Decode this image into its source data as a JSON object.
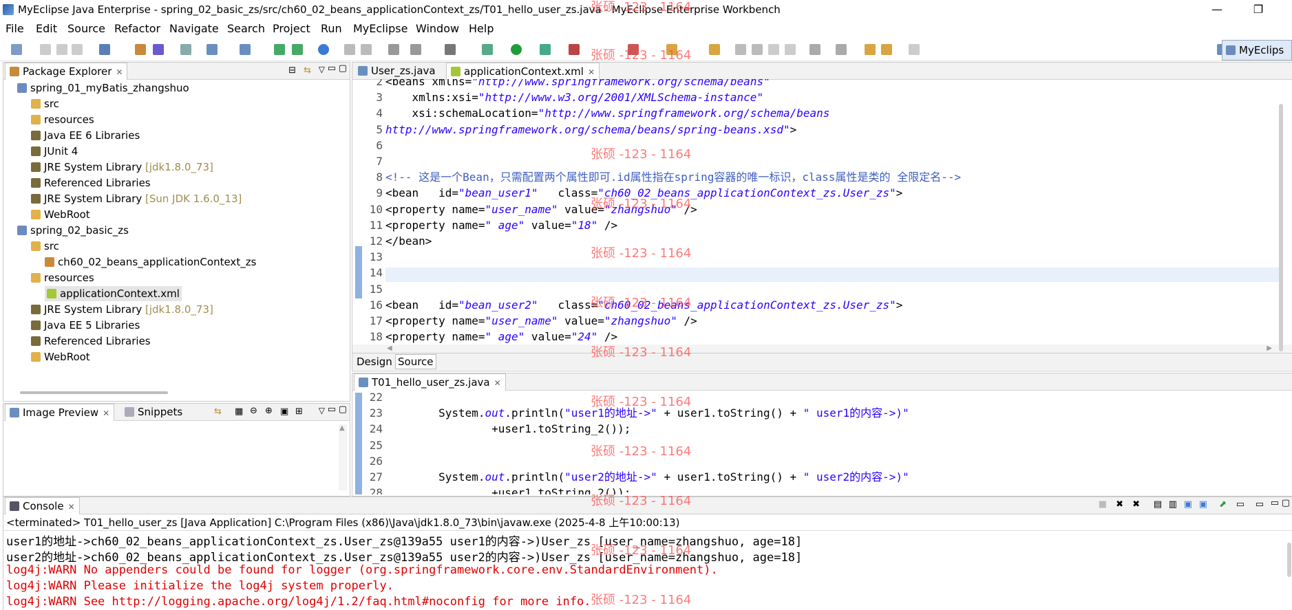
{
  "window": {
    "title": "MyEclipse Java Enterprise - spring_02_basic_zs/src/ch60_02_beans_applicationContext_zs/T01_hello_user_zs.java - MyEclipse Enterprise Workbench",
    "minimize": "—",
    "maximize": "❐"
  },
  "menu": [
    "File",
    "Edit",
    "Source",
    "Refactor",
    "Navigate",
    "Search",
    "Project",
    "Run",
    "MyEclipse",
    "Window",
    "Help"
  ],
  "perspective": "MyEclips",
  "package_explorer": {
    "tab": "Package Explorer",
    "items": [
      {
        "label": "spring_01_myBatis_zhangshuo",
        "suffix": "",
        "type": "proj",
        "level": 0
      },
      {
        "label": "src",
        "suffix": "",
        "type": "folder",
        "level": 1
      },
      {
        "label": "resources",
        "suffix": "",
        "type": "folder",
        "level": 1
      },
      {
        "label": "Java EE 6 Libraries",
        "suffix": "",
        "type": "lib",
        "level": 1
      },
      {
        "label": "JUnit 4",
        "suffix": "",
        "type": "lib",
        "level": 1
      },
      {
        "label": "JRE System Library",
        "suffix": " [jdk1.8.0_73]",
        "type": "lib",
        "level": 1
      },
      {
        "label": "Referenced Libraries",
        "suffix": "",
        "type": "lib",
        "level": 1
      },
      {
        "label": "JRE System Library",
        "suffix": " [Sun JDK 1.6.0_13]",
        "type": "lib",
        "level": 1
      },
      {
        "label": "WebRoot",
        "suffix": "",
        "type": "folder",
        "level": 1
      },
      {
        "label": "spring_02_basic_zs",
        "suffix": "",
        "type": "proj",
        "level": 0
      },
      {
        "label": "src",
        "suffix": "",
        "type": "folder",
        "level": 1
      },
      {
        "label": "ch60_02_beans_applicationContext_zs",
        "suffix": "",
        "type": "pkg",
        "level": 2
      },
      {
        "label": "resources",
        "suffix": "",
        "type": "folder",
        "level": 1
      },
      {
        "label": "applicationContext.xml",
        "suffix": "",
        "type": "xml",
        "level": 2,
        "selected": true
      },
      {
        "label": "JRE System Library",
        "suffix": " [jdk1.8.0_73]",
        "type": "lib",
        "level": 1
      },
      {
        "label": "Java EE 5 Libraries",
        "suffix": "",
        "type": "lib",
        "level": 1
      },
      {
        "label": "Referenced Libraries",
        "suffix": "",
        "type": "lib",
        "level": 1
      },
      {
        "label": "WebRoot",
        "suffix": "",
        "type": "folder",
        "level": 1
      }
    ]
  },
  "bottom_left": {
    "tab1": "Image Preview",
    "tab2": "Snippets"
  },
  "editor_top": {
    "tab1": "User_zs.java",
    "tab2": "applicationContext.xml",
    "lines": [
      {
        "n": "2",
        "html": "&lt;beans xmlns=<span class='str'>\"http://www.springframework.org/schema/beans\"</span>"
      },
      {
        "n": "3",
        "html": "    xmlns:xsi=<span class='str'>\"http://www.w3.org/2001/XMLSchema-instance\"</span>"
      },
      {
        "n": "4",
        "html": "    xsi:schemaLocation=<span class='str'>\"http://www.springframework.org/schema/beans</span>"
      },
      {
        "n": "5",
        "html": "<span class='str'>http://www.springframework.org/schema/beans/spring-beans.xsd\"</span>&gt;"
      },
      {
        "n": "6",
        "html": ""
      },
      {
        "n": "7",
        "html": ""
      },
      {
        "n": "8",
        "html": "<span class='cmt'>&lt;!-- 这是一个Bean，只需配置两个属性即可.id属性指在spring容器的唯一标识，class属性是类的 全限定名--&gt;</span>"
      },
      {
        "n": "9",
        "html": "&lt;bean   id=<span class='str'>\"bean_user1\"</span>   class=<span class='str'>\"ch60_02_beans_applicationContext_zs.User_zs\"</span>&gt;"
      },
      {
        "n": "10",
        "html": "&lt;property name=<span class='str'>\"user_name\"</span> value=<span class='str'>\"zhangshuo\"</span> /&gt;"
      },
      {
        "n": "11",
        "html": "&lt;property name=<span class='str'>\" age\"</span> value=<span class='str'>\"18\"</span> /&gt;"
      },
      {
        "n": "12",
        "html": "&lt;/bean&gt;"
      },
      {
        "n": "13",
        "html": ""
      },
      {
        "n": "14",
        "html": ""
      },
      {
        "n": "15",
        "html": ""
      },
      {
        "n": "16",
        "html": "&lt;bean   id=<span class='str'>\"bean_user2\"</span>   class=<span class='str'>\"ch60_02_beans_applicationContext_zs.User_zs\"</span>&gt;"
      },
      {
        "n": "17",
        "html": "&lt;property name=<span class='str'>\"user_name\"</span> value=<span class='str'>\"zhangshuo\"</span> /&gt;"
      },
      {
        "n": "18",
        "html": "&lt;property name=<span class='str'>\" age\"</span> value=<span class='str'>\"24\"</span> /&gt;"
      }
    ],
    "design_tab": "Design",
    "source_tab": "Source"
  },
  "editor_java": {
    "tab": "T01_hello_user_zs.java",
    "lines": [
      {
        "n": "22",
        "html": ""
      },
      {
        "n": "23",
        "html": "        System.<span class='str'>out</span>.println(<span class='str' style='font-style:normal'>\"user1的地址-&gt;\"</span> + user1.toString() + <span class='str' style='font-style:normal'>\" user1的内容-&gt;)\"</span>"
      },
      {
        "n": "24",
        "html": "                +user1.toString_2());"
      },
      {
        "n": "25",
        "html": ""
      },
      {
        "n": "26",
        "html": ""
      },
      {
        "n": "27",
        "html": "        System.<span class='str'>out</span>.println(<span class='str' style='font-style:normal'>\"user2的地址-&gt;\"</span> + user1.toString() + <span class='str' style='font-style:normal'>\" user2的内容-&gt;)\"</span>"
      },
      {
        "n": "28",
        "html": "                +user1.toString_2());"
      }
    ]
  },
  "console": {
    "tab": "Console",
    "status": "<terminated> T01_hello_user_zs [Java Application] C:\\Program Files (x86)\\Java\\jdk1.8.0_73\\bin\\javaw.exe (2025-4-8 上午10:00:13)",
    "lines": [
      {
        "text": "user1的地址->ch60_02_beans_applicationContext_zs.User_zs@139a55 user1的内容->)User_zs [user_name=zhangshuo, age=18]",
        "color": "#000000"
      },
      {
        "text": "user2的地址->ch60_02_beans_applicationContext_zs.User_zs@139a55 user2的内容->)User_zs [user_name=zhangshuo, age=18]",
        "color": "#000000"
      },
      {
        "text": "log4j:WARN No appenders could be found for logger (org.springframework.core.env.StandardEnvironment).",
        "color": "#e00000"
      },
      {
        "text": "log4j:WARN Please initialize the log4j system properly.",
        "color": "#e00000"
      },
      {
        "text": "log4j:WARN See http://logging.apache.org/log4j/1.2/faq.html#noconfig for more info.",
        "color": "#e00000"
      }
    ]
  },
  "watermark": "张硕 -123 - 1164"
}
